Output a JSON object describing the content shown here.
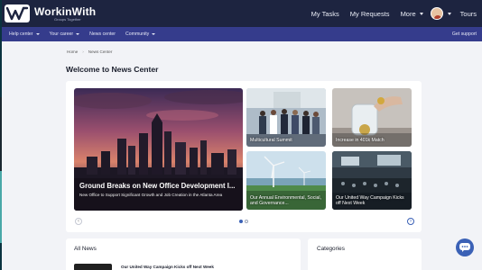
{
  "app": {
    "name": "WorkinWith",
    "tagline": "Groups Together"
  },
  "topnav": {
    "my_tasks": "My Tasks",
    "my_requests": "My Requests",
    "more": "More",
    "tours": "Tours"
  },
  "subnav": {
    "items": [
      {
        "label": "Help center"
      },
      {
        "label": "Your career"
      },
      {
        "label": "News center"
      },
      {
        "label": "Community"
      }
    ],
    "get_support": "Get support"
  },
  "breadcrumb": {
    "home": "Home",
    "current": "News Center"
  },
  "page": {
    "title": "Welcome to News Center"
  },
  "carousel": {
    "feature": {
      "title": "Ground Breaks on New Office Development I...",
      "subtitle": "New Office to Support Significant Growth and Job Creation in the Atlanta Area"
    },
    "tiles": [
      {
        "caption": "Multicultural Summit"
      },
      {
        "caption": "Increase in 401k Match"
      },
      {
        "caption": "Our Annual Environmental, Social, and Governance..."
      },
      {
        "caption": "Our United Way Campaign Kicks off Next Week"
      }
    ],
    "active_slide": 1,
    "slide_count": 2
  },
  "all_news": {
    "title": "All News",
    "items": [
      {
        "title": "Our United Way Campaign Kicks off Next Week"
      }
    ]
  },
  "categories": {
    "title": "Categories"
  },
  "colors": {
    "topbar": "#1d2440",
    "subnav": "#353c8c",
    "accent": "#3b61b6",
    "page_bg": "#f2f3f7"
  }
}
